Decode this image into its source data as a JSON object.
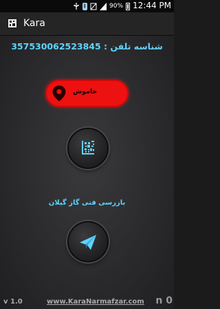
{
  "status_bar": {
    "battery_percent": "90%",
    "time": "12:44 PM",
    "icons": [
      "usb-icon",
      "bluetooth-icon",
      "no-sim-icon",
      "signal-icon",
      "battery-icon"
    ]
  },
  "action_bar": {
    "app_icon": "barcode-app-icon",
    "title": "Kara"
  },
  "main": {
    "phone_id_text": "شناسه تلفن : 357530062523845",
    "status_button_label": "خاموش",
    "status_icon": "location-pin-icon",
    "barcode_icon": "qr-code-icon",
    "company_text": "بازرسی فنی گاز گیلان",
    "send_icon": "paper-plane-icon"
  },
  "footer": {
    "version": "v 1.0",
    "website": "www.KaraNarmafzar.com",
    "counter": "n 0"
  },
  "colors": {
    "accent_cyan": "#5fd3ff",
    "status_red": "#ee1111"
  }
}
